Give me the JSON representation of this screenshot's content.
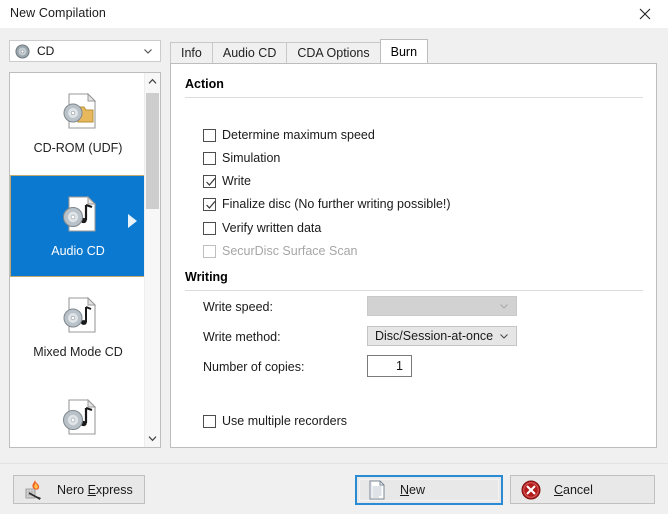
{
  "window": {
    "title": "New Compilation",
    "close_icon": "close-icon"
  },
  "device_selector": {
    "icon": "disc-icon",
    "value": "CD",
    "arrow_icon": "chevron-down-icon"
  },
  "compilation_types": {
    "scrollbar": {
      "up_icon": "chevron-up-icon",
      "down_icon": "chevron-down-icon"
    },
    "items": [
      {
        "label": "CD-ROM (UDF)",
        "icon": "cd-folder-doc-icon",
        "selected": false
      },
      {
        "label": "Audio CD",
        "icon": "cd-music-doc-icon",
        "selected": true
      },
      {
        "label": "Mixed Mode CD",
        "icon": "cd-note-doc-icon",
        "selected": false
      },
      {
        "label": "",
        "icon": "cd-music-doc-icon",
        "selected": false
      }
    ]
  },
  "tabs": [
    {
      "label": "Info",
      "active": false
    },
    {
      "label": "Audio CD",
      "active": false
    },
    {
      "label": "CDA Options",
      "active": false
    },
    {
      "label": "Burn",
      "active": true
    }
  ],
  "burn_panel": {
    "action": {
      "title": "Action",
      "checkboxes": [
        {
          "label": "Determine maximum speed",
          "checked": false,
          "disabled": false
        },
        {
          "label": "Simulation",
          "checked": false,
          "disabled": false
        },
        {
          "label": "Write",
          "checked": true,
          "disabled": false
        },
        {
          "label": "Finalize disc (No further writing possible!)",
          "checked": true,
          "disabled": false
        },
        {
          "label": "Verify written data",
          "checked": false,
          "disabled": false
        },
        {
          "label": "SecurDisc Surface Scan",
          "checked": false,
          "disabled": true
        }
      ]
    },
    "writing": {
      "title": "Writing",
      "write_speed": {
        "label": "Write speed:",
        "value": "",
        "disabled": true,
        "arrow_icon": "chevron-down-icon"
      },
      "write_method": {
        "label": "Write method:",
        "value": "Disc/Session-at-once",
        "disabled": false,
        "arrow_icon": "chevron-down-icon"
      },
      "number_of_copies": {
        "label": "Number of copies:",
        "value": "1"
      },
      "use_multiple_recorders": {
        "label": "Use multiple recorders",
        "checked": false
      }
    }
  },
  "footer": {
    "nero_express": {
      "label_pre": "Nero ",
      "accel": "E",
      "label_post": "xpress",
      "icon": "nero-flame-icon"
    },
    "new": {
      "label_pre": "",
      "accel": "N",
      "label_post": "ew",
      "icon": "new-document-icon",
      "focused": true
    },
    "cancel": {
      "label_pre": "",
      "accel": "C",
      "label_post": "ancel",
      "icon": "cancel-x-icon"
    }
  },
  "colors": {
    "selection_blue": "#0b79d0",
    "focus_blue": "#2a8ad4",
    "cancel_red": "#b21c1c",
    "panel_bg": "#f0f0f0"
  }
}
